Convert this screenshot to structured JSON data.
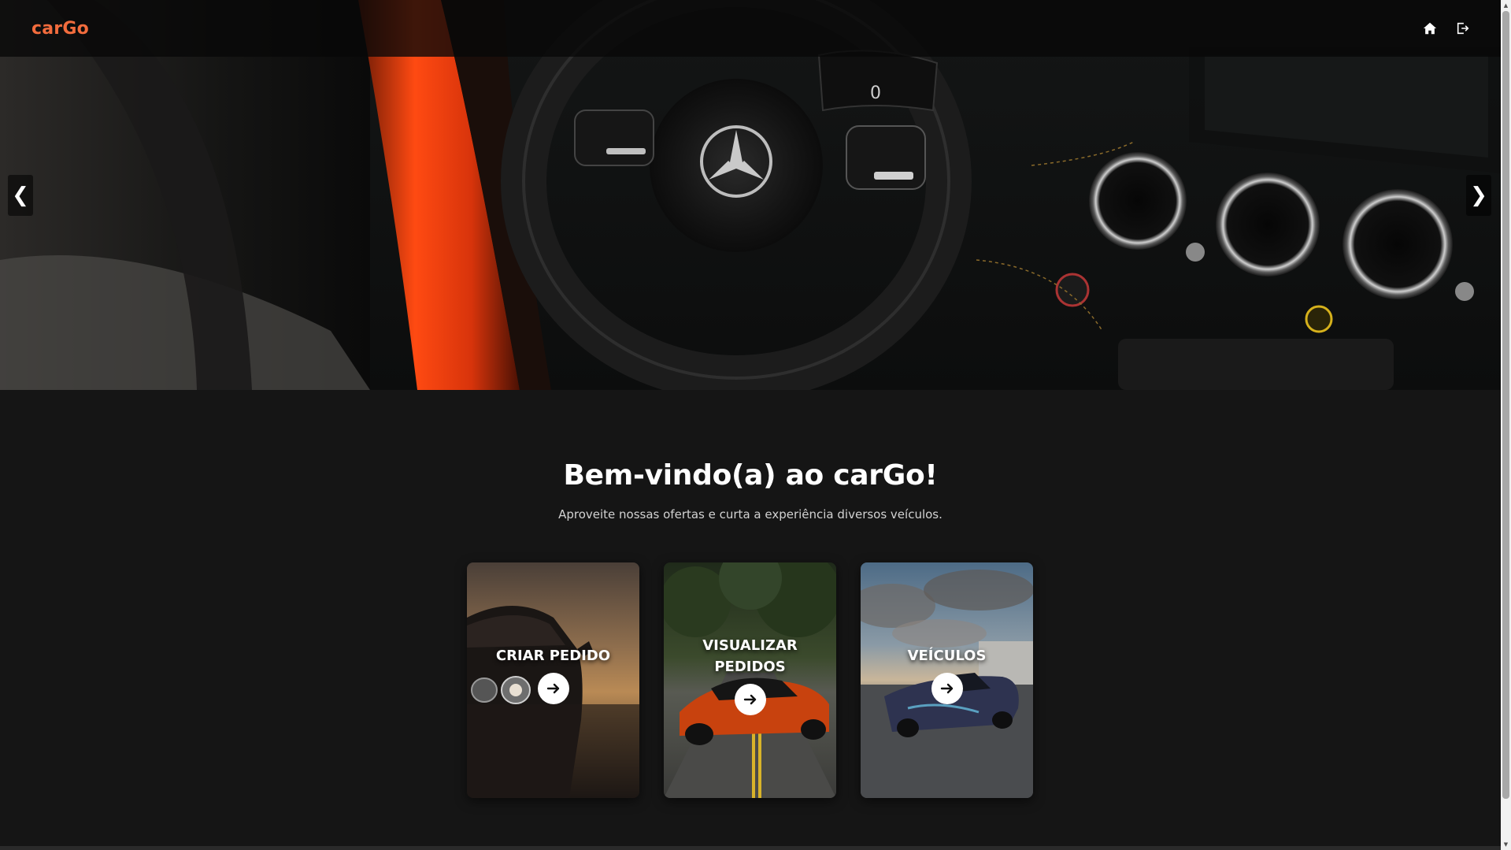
{
  "navbar": {
    "brand": "carGo",
    "icons": [
      "home-icon",
      "logout-icon"
    ]
  },
  "carousel": {
    "prev_label": "❮",
    "next_label": "❯"
  },
  "welcome": {
    "title": "Bem-vindo(a) ao carGo!",
    "subtitle": "Aproveite nossas ofertas e curta a experiência diversos veículos."
  },
  "cards": [
    {
      "title": "CRIAR PEDIDO"
    },
    {
      "title": "VISUALIZAR PEDIDOS"
    },
    {
      "title": "VEÍCULOS"
    }
  ],
  "colors": {
    "brand": "#f26c3d",
    "background": "#151515",
    "card_arrow_bg": "#ffffff"
  }
}
